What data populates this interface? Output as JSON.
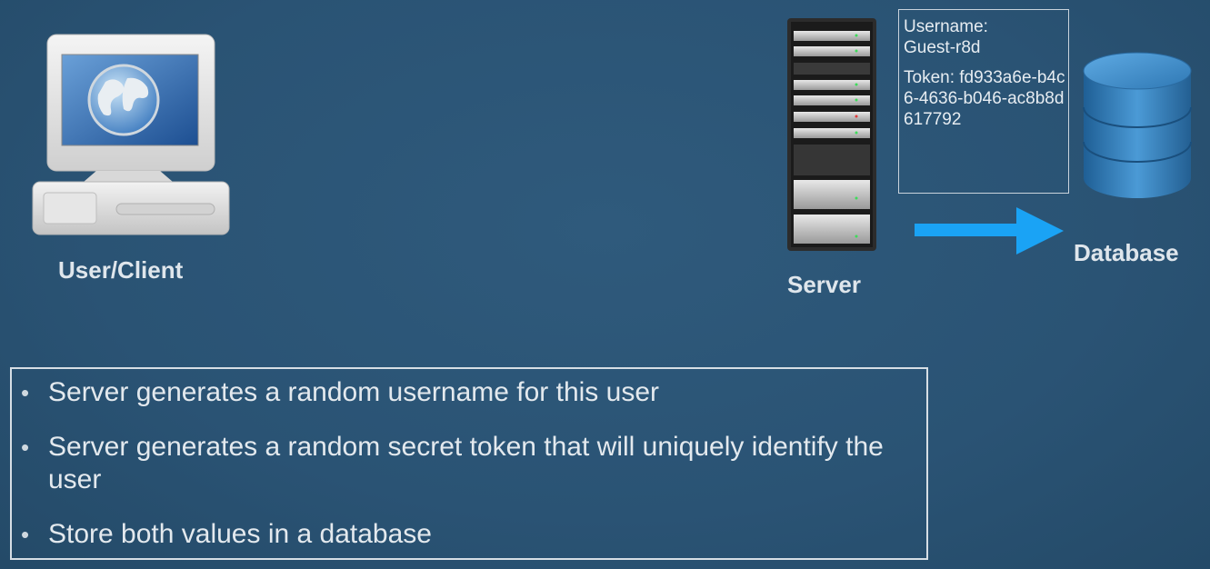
{
  "nodes": {
    "client": {
      "label": "User/Client",
      "icon": "computer-globe-icon"
    },
    "server": {
      "label": "Server",
      "icon": "server-rack-icon"
    },
    "database": {
      "label": "Database",
      "icon": "database-cylinder-icon"
    }
  },
  "credentials": {
    "username_label": "Username:",
    "username_value": "Guest-r8d",
    "token_text": "Token: fd933a6e-b4c6-4636-b046-ac8b8d617792"
  },
  "arrow": {
    "direction": "server-to-database",
    "color": "#1aa3f5"
  },
  "bullets": [
    "Server generates a random username for this user",
    "Server generates a random secret token that will uniquely identify the user",
    "Store both values in a database"
  ],
  "colors": {
    "background": "#2a5374",
    "text": "#e3e9ee",
    "arrow": "#1aa3f5",
    "database": "#3d8bc7"
  }
}
